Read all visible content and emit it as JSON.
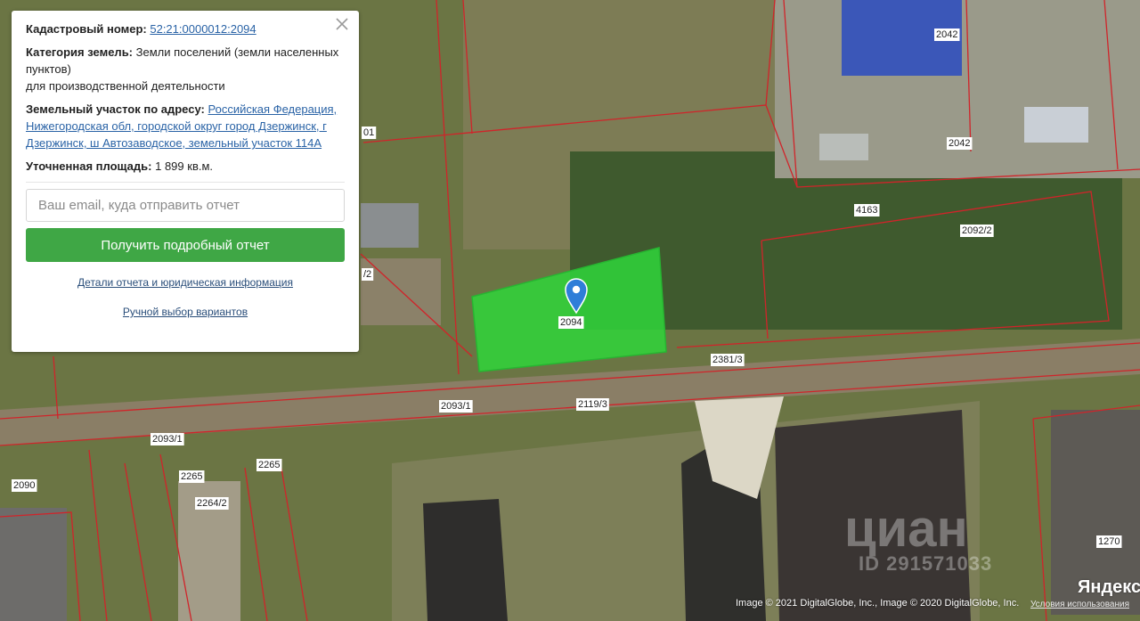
{
  "panel": {
    "cadastral_label": "Кадастровый номер:",
    "cadastral_value": "52:21:0000012:2094",
    "category_label": "Категория земель:",
    "category_value": "Земли поселений (земли населенных пунктов)",
    "category_use": "для производственной деятельности",
    "address_label": "Земельный участок по адресу:",
    "address_value": "Российская Федерация, Нижегородская обл, городской округ город Дзержинск, г Дзержинск, ш Автозаводское, земельный участок 114А",
    "area_label": "Уточненная площадь:",
    "area_value": "1 899 кв.м.",
    "email_placeholder": "Ваш email, куда отправить отчет",
    "report_button": "Получить подробный отчет",
    "details_link": "Детали отчета и юридическая информация",
    "manual_link": "Ручной выбор вариантов"
  },
  "map": {
    "plot_labels": [
      "2042",
      "2042",
      "4163",
      "2092/2",
      "2381/3",
      "2093/1",
      "2119/3",
      "2093/1",
      "2090",
      "2265",
      "2265",
      "2264/2",
      "1270",
      "2094",
      "/2",
      "01"
    ],
    "selected_plot": "2094",
    "copyright": "Image © 2021 DigitalGlobe, Inc., Image © 2020 DigitalGlobe, Inc.",
    "terms": "Условия использования",
    "brand": "Яндекс",
    "watermark": "циан",
    "watermark_id": "ID 291571033",
    "colors": {
      "boundary": "#d0242a",
      "selected_fill": "#2fd63a",
      "button": "#3fa745",
      "marker": "#2f7ed8"
    }
  }
}
